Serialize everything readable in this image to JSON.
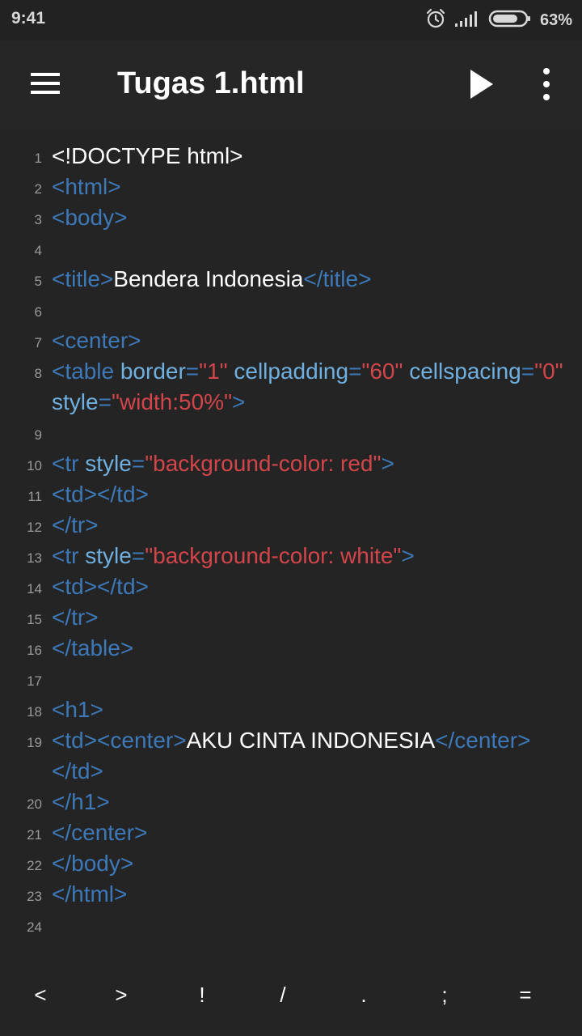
{
  "status_bar": {
    "time": "9:41",
    "battery": "63%",
    "icons": [
      "alarm-icon",
      "signal-icon",
      "battery-icon"
    ]
  },
  "app_bar": {
    "title": "Tugas 1.html",
    "icons": [
      "menu-icon",
      "play-icon",
      "more-vert-icon"
    ]
  },
  "colors": {
    "background": "#242424",
    "tag": "#3d79b8",
    "attribute": "#6fb0e0",
    "string": "#d2454a",
    "text": "#ffffff",
    "line_number": "#9a9a9a"
  },
  "editor": {
    "lines": [
      {
        "n": "1",
        "tokens": [
          {
            "t": "txt",
            "v": "<!DOCTYPE html>"
          }
        ]
      },
      {
        "n": "2",
        "tokens": [
          {
            "t": "tag",
            "v": "<html>"
          }
        ]
      },
      {
        "n": "3",
        "tokens": [
          {
            "t": "tag",
            "v": "<body>"
          }
        ]
      },
      {
        "n": "4",
        "tokens": []
      },
      {
        "n": "5",
        "tokens": [
          {
            "t": "tag",
            "v": "<title>"
          },
          {
            "t": "txt",
            "v": "Bendera Indonesia"
          },
          {
            "t": "tag",
            "v": "</title>"
          }
        ]
      },
      {
        "n": "6",
        "tokens": []
      },
      {
        "n": "7",
        "tokens": [
          {
            "t": "tag",
            "v": "<center>"
          }
        ]
      },
      {
        "n": "8",
        "wrap": true,
        "tokens": [
          {
            "t": "tag",
            "v": "<table"
          },
          {
            "t": "sp",
            "v": " "
          },
          {
            "t": "attr",
            "v": "border"
          },
          {
            "t": "tag",
            "v": "="
          },
          {
            "t": "str",
            "v": "\"1\""
          },
          {
            "t": "sp",
            "v": " "
          },
          {
            "t": "attr",
            "v": "cellpadding"
          },
          {
            "t": "tag",
            "v": "="
          },
          {
            "t": "str",
            "v": "\"60\""
          },
          {
            "t": "sp",
            "v": " "
          },
          {
            "t": "attr",
            "v": "cellspacing"
          },
          {
            "t": "tag",
            "v": "="
          },
          {
            "t": "str",
            "v": "\"0\""
          },
          {
            "t": "sp",
            "v": " "
          },
          {
            "t": "attr",
            "v": "style"
          },
          {
            "t": "tag",
            "v": "="
          },
          {
            "t": "str",
            "v": "\"width:50%\""
          },
          {
            "t": "tag",
            "v": ">"
          }
        ]
      },
      {
        "n": "9",
        "tokens": []
      },
      {
        "n": "10",
        "tokens": [
          {
            "t": "tag",
            "v": "<tr"
          },
          {
            "t": "sp",
            "v": " "
          },
          {
            "t": "attr",
            "v": "style"
          },
          {
            "t": "tag",
            "v": "="
          },
          {
            "t": "str",
            "v": "\"background-color: red\""
          },
          {
            "t": "tag",
            "v": ">"
          }
        ]
      },
      {
        "n": "11",
        "tokens": [
          {
            "t": "tag",
            "v": "<td></td>"
          }
        ]
      },
      {
        "n": "12",
        "tokens": [
          {
            "t": "tag",
            "v": "</tr>"
          }
        ]
      },
      {
        "n": "13",
        "tokens": [
          {
            "t": "tag",
            "v": "<tr"
          },
          {
            "t": "sp",
            "v": " "
          },
          {
            "t": "attr",
            "v": "style"
          },
          {
            "t": "tag",
            "v": "="
          },
          {
            "t": "str",
            "v": "\"background-color: white\""
          },
          {
            "t": "tag",
            "v": ">"
          }
        ]
      },
      {
        "n": "14",
        "tokens": [
          {
            "t": "tag",
            "v": "<td></td>"
          }
        ]
      },
      {
        "n": "15",
        "tokens": [
          {
            "t": "tag",
            "v": "</tr>"
          }
        ]
      },
      {
        "n": "16",
        "tokens": [
          {
            "t": "tag",
            "v": "</table>"
          }
        ]
      },
      {
        "n": "17",
        "tokens": []
      },
      {
        "n": "18",
        "tokens": [
          {
            "t": "tag",
            "v": "<h1>"
          }
        ]
      },
      {
        "n": "19",
        "wrap": true,
        "tokens": [
          {
            "t": "tag",
            "v": "<td><center>"
          },
          {
            "t": "txt",
            "v": "AKU CINTA INDONESIA"
          },
          {
            "t": "tag",
            "v": "</center></td>"
          }
        ]
      },
      {
        "n": "20",
        "tokens": [
          {
            "t": "tag",
            "v": "</h1>"
          }
        ]
      },
      {
        "n": "21",
        "tokens": [
          {
            "t": "tag",
            "v": "</center>"
          }
        ]
      },
      {
        "n": "22",
        "tokens": [
          {
            "t": "tag",
            "v": "</body>"
          }
        ]
      },
      {
        "n": "23",
        "tokens": [
          {
            "t": "tag",
            "v": "</html>"
          }
        ]
      },
      {
        "n": "24",
        "tokens": []
      }
    ]
  },
  "key_bar": {
    "keys": [
      "<",
      ">",
      "!",
      "/",
      ".",
      ";",
      "="
    ]
  }
}
